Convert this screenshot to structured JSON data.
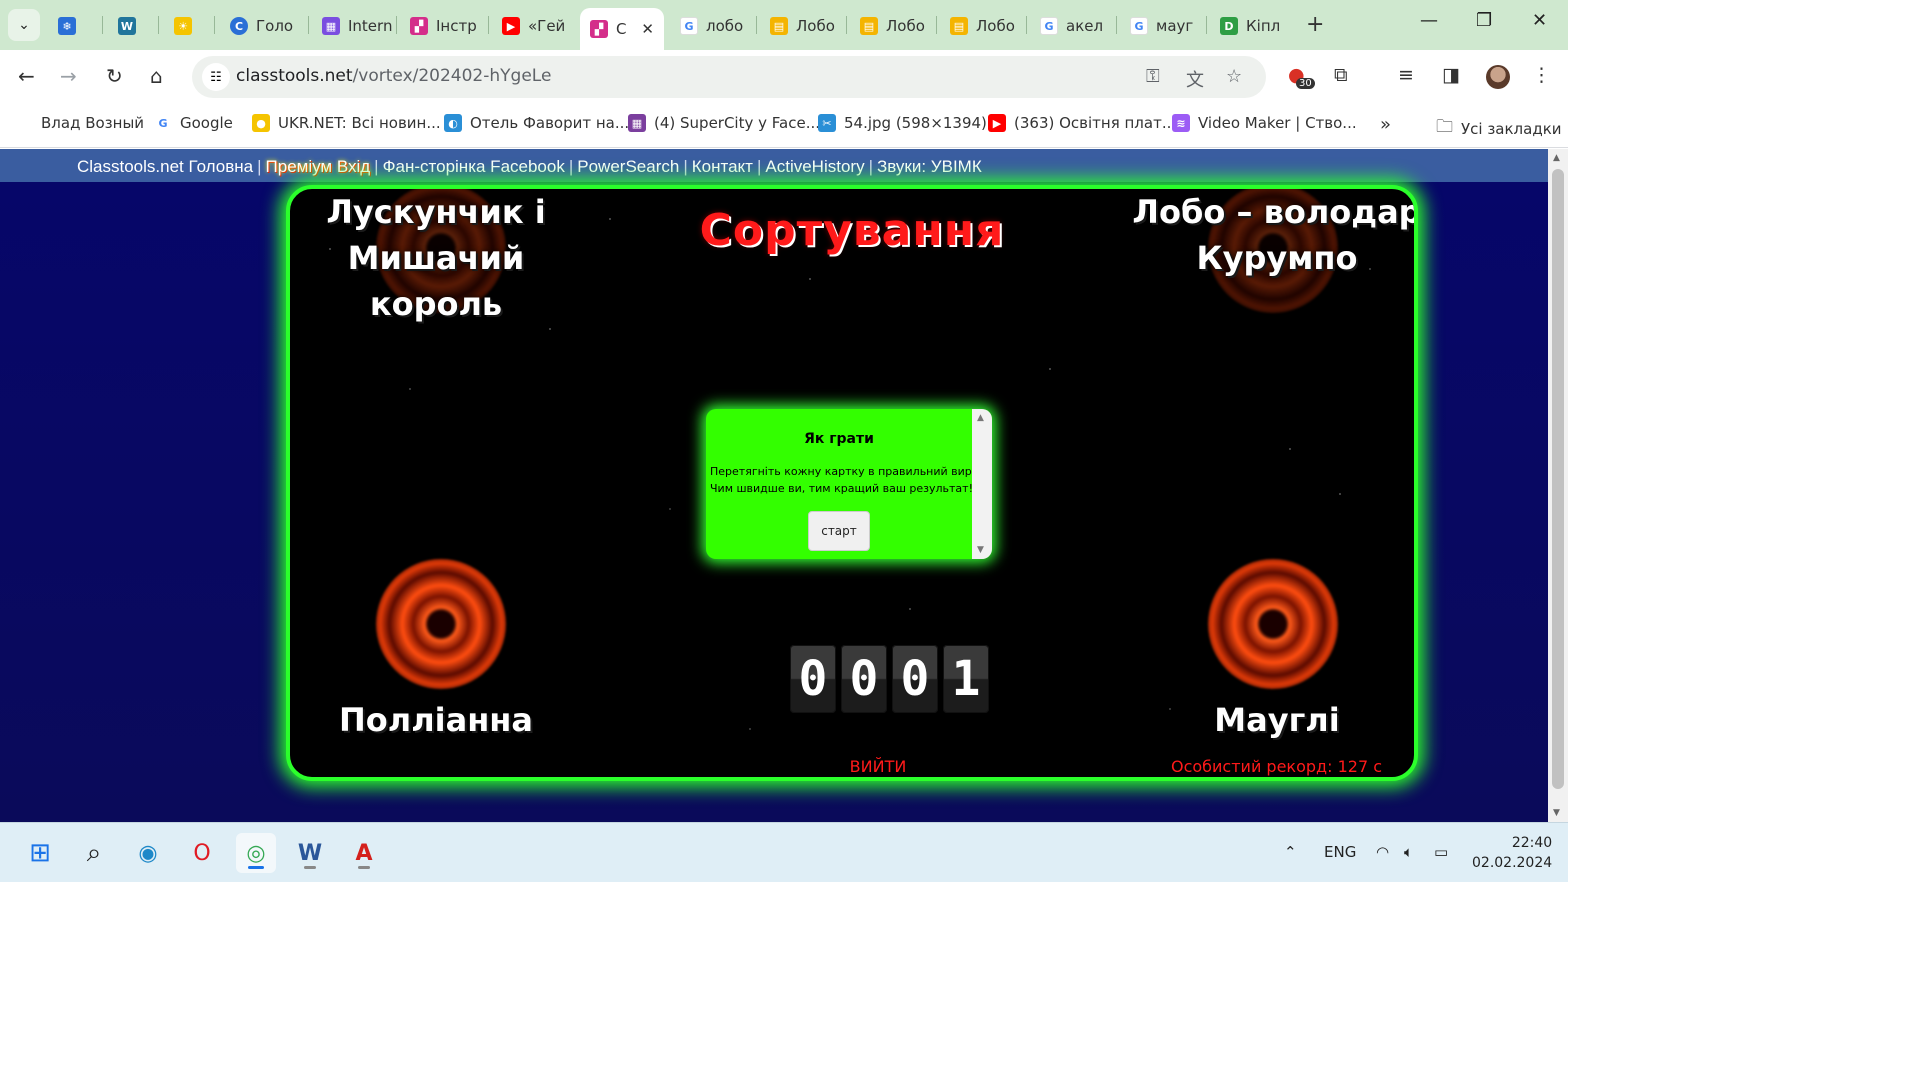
{
  "browser": {
    "tabs": [
      {
        "label": "",
        "fav_color": "#2a6fd6",
        "fav_char": "❄"
      },
      {
        "label": "",
        "fav_color": "#21759b",
        "fav_char": "W"
      },
      {
        "label": "",
        "fav_color": "#f5c400",
        "fav_char": "☀"
      },
      {
        "label": "Голо",
        "fav_color": "#2a6fd6",
        "fav_char": "C"
      },
      {
        "label": "Intern",
        "fav_color": "#7a4ee0",
        "fav_char": "▦"
      },
      {
        "label": "Інстр",
        "fav_color": "#d42e8a",
        "fav_char": "▞"
      },
      {
        "label": "«Гей",
        "fav_color": "#ff0000",
        "fav_char": "▶"
      },
      {
        "label": "С",
        "fav_color": "#d42e8a",
        "fav_char": "▞",
        "active": true
      },
      {
        "label": "лобо",
        "fav_color": "#4285f4",
        "fav_char": "G"
      },
      {
        "label": "Лобо",
        "fav_color": "#f4b400",
        "fav_char": "▤"
      },
      {
        "label": "Лобо",
        "fav_color": "#f4b400",
        "fav_char": "▤"
      },
      {
        "label": "Лобо",
        "fav_color": "#f4b400",
        "fav_char": "▤"
      },
      {
        "label": "акел",
        "fav_color": "#4285f4",
        "fav_char": "G"
      },
      {
        "label": "мауг",
        "fav_color": "#4285f4",
        "fav_char": "G"
      },
      {
        "label": "Кіпл",
        "fav_color": "#2e9e44",
        "fav_char": "D"
      }
    ],
    "close_tab_char": "✕",
    "new_tab_char": "+",
    "url_host": "classtools.net",
    "url_path": "/vortex/202402-hYgeLe",
    "extension_badge": "30",
    "bookmarks": [
      {
        "label": "Влад Возный",
        "fav_color": "",
        "fav_char": ""
      },
      {
        "label": "Google",
        "fav_color": "#4285f4",
        "fav_char": "G"
      },
      {
        "label": "UKR.NET: Всі новин...",
        "fav_color": "#f5c400",
        "fav_char": "●"
      },
      {
        "label": "Отель Фаворит на...",
        "fav_color": "#2a8fd6",
        "fav_char": "◐"
      },
      {
        "label": "(4) SuperCity у Face...",
        "fav_color": "#7b3f9e",
        "fav_char": "▦"
      },
      {
        "label": "54.jpg (598×1394)",
        "fav_color": "#2a8fd6",
        "fav_char": "✂"
      },
      {
        "label": "(363) Освітня плат...",
        "fav_color": "#ff0000",
        "fav_char": "▶"
      },
      {
        "label": "Video Maker | Ство...",
        "fav_color": "#9c5cf5",
        "fav_char": "≋"
      }
    ],
    "all_bookmarks_label": "Усі закладки"
  },
  "site_nav": {
    "items": [
      "Classtools.net Головна",
      "Преміум Вхід",
      "Фан-сторінка Facebook",
      "PowerSearch",
      "Контакт",
      "ActiveHistory",
      "Звуки: УВІМК"
    ],
    "separator": "|"
  },
  "game": {
    "title": "Сортування",
    "categories": {
      "top_left": "Лускунчик і Мишачий король",
      "top_right": "Лобо – володар Курумпо",
      "bottom_left": "Полліанна",
      "bottom_right": "Мауглі"
    },
    "howto": {
      "heading": "Як грати",
      "line1": "Перетягніть кожну картку в правильний вир.",
      "line2": "Чим швидше ви, тим кращий ваш результат!",
      "start_label": "старт"
    },
    "counter_digits": [
      "0",
      "0",
      "0",
      "1"
    ],
    "exit_label": "ВИЙТИ",
    "record_label": "Особистий рекорд: 127 с"
  },
  "taskbar": {
    "lang": "ENG",
    "time": "22:40",
    "date": "02.02.2024"
  },
  "colors": {
    "board_border": "#2bff2b",
    "title_red": "#ff1a1a",
    "howto_bg": "#33ff00",
    "site_nav_bg": "#3a5da0",
    "tab_strip_bg": "#cfe8cf"
  }
}
